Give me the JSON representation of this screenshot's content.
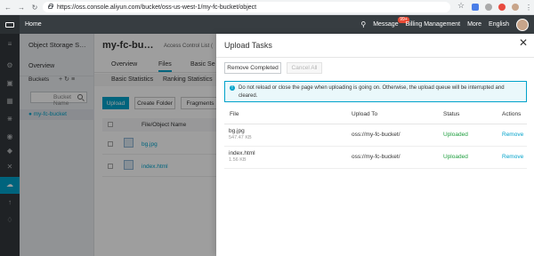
{
  "browser": {
    "url": "https://oss.console.aliyun.com/bucket/oss-us-west-1/my-fc-bucket/object"
  },
  "topbar": {
    "home": "Home",
    "message": "Message",
    "message_badge": "99+",
    "billing": "Billing Management",
    "more": "More",
    "language": "English"
  },
  "sidebar": {
    "title": "Object Storage S…",
    "overview": "Overview",
    "buckets": "Buckets",
    "bucket_search_placeholder": "Bucket Name",
    "bucket_item": "my-fc-bucket"
  },
  "main": {
    "bucket_title": "my-fc-bu…",
    "acl": "Access Control List (",
    "tabs": [
      "Overview",
      "Files",
      "Basic Se"
    ],
    "subtabs": [
      "Basic Statistics",
      "Ranking Statistics"
    ],
    "toolbar": [
      "Upload",
      "Create Folder",
      "Fragments"
    ],
    "file_column": "File/Object Name",
    "files": [
      "bg.jpg",
      "index.html"
    ]
  },
  "panel": {
    "title": "Upload Tasks",
    "remove_completed": "Remove Completed",
    "cancel_all": "Cancel All",
    "notice": "Do not reload or close the page when uploading is going on. Otherwise, the upload queue will be interrupted and cleared.",
    "columns": {
      "file": "File",
      "upload_to": "Upload To",
      "status": "Status",
      "actions": "Actions"
    },
    "rows": [
      {
        "name": "bg.jpg",
        "size": "547.47 KB",
        "to": "oss://my-fc-bucket/",
        "status": "Uploaded",
        "action": "Remove"
      },
      {
        "name": "index.html",
        "size": "1.56 KB",
        "to": "oss://my-fc-bucket/",
        "status": "Uploaded",
        "action": "Remove"
      }
    ]
  },
  "colors": {
    "accent": "#00a2ca",
    "topbar": "#373d41",
    "success": "#1e9e3e"
  }
}
